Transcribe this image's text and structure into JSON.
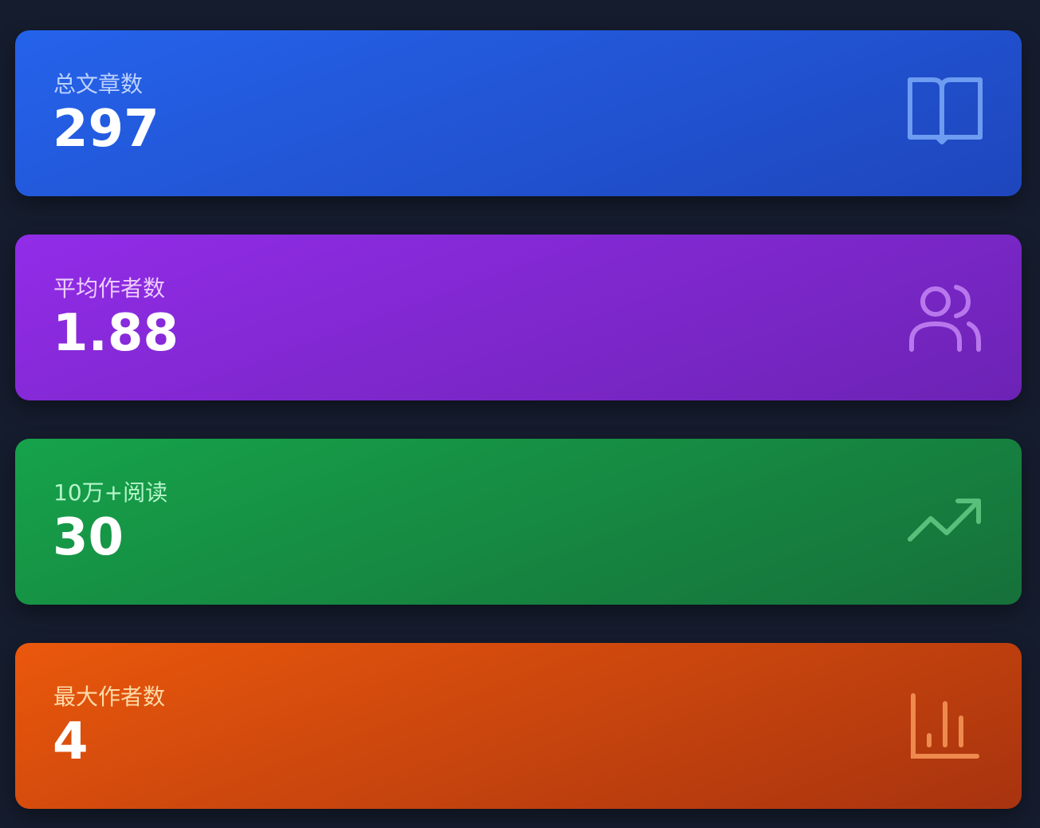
{
  "cards": [
    {
      "label": "总文章数",
      "value": "297",
      "icon": "book-open-icon",
      "color": "#2563eb"
    },
    {
      "label": "平均作者数",
      "value": "1.88",
      "icon": "users-icon",
      "color": "#9333ea"
    },
    {
      "label": "10万+阅读",
      "value": "30",
      "icon": "trending-up-icon",
      "color": "#16a34a"
    },
    {
      "label": "最大作者数",
      "value": "4",
      "icon": "bar-chart-icon",
      "color": "#ea580c"
    }
  ]
}
